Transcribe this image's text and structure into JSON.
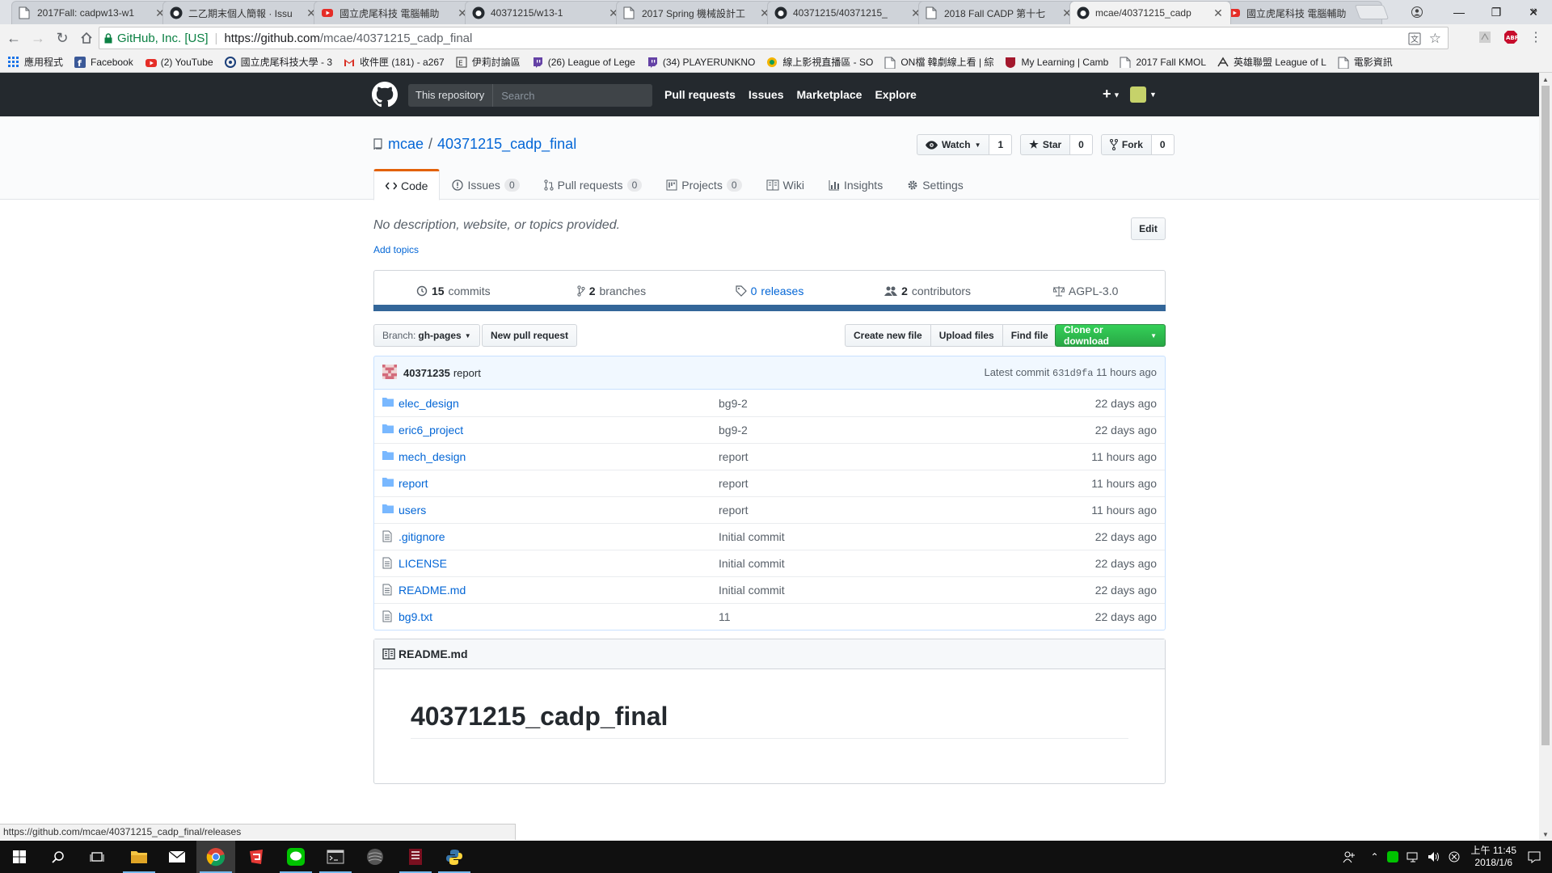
{
  "browser": {
    "tabs": [
      {
        "title": "2017Fall: cadpw13-w1",
        "favicon": "page-icon",
        "active": false
      },
      {
        "title": "二乙期末個人簡報 · Issu",
        "favicon": "github-icon",
        "active": false
      },
      {
        "title": "國立虎尾科技 電腦輔助",
        "favicon": "youtube-icon",
        "active": false
      },
      {
        "title": "40371215/w13-1",
        "favicon": "github-icon",
        "active": false
      },
      {
        "title": "2017 Spring 機械設計工",
        "favicon": "page-icon",
        "active": false
      },
      {
        "title": "40371215/40371215_",
        "favicon": "github-icon",
        "active": false
      },
      {
        "title": "2018 Fall CADP 第十七",
        "favicon": "page-icon",
        "active": false
      },
      {
        "title": "mcae/40371215_cadp",
        "favicon": "github-icon",
        "active": true
      },
      {
        "title": "國立虎尾科技 電腦輔助",
        "favicon": "youtube-icon",
        "active": false
      }
    ],
    "secure_label": "GitHub, Inc. [US]",
    "url_host": "https://github.com",
    "url_path": "/mcae/40371215_cadp_final",
    "bookmarks": [
      {
        "label": "應用程式",
        "icon": "apps-icon"
      },
      {
        "label": "Facebook",
        "icon": "facebook-icon"
      },
      {
        "label": "(2) YouTube",
        "icon": "youtube-icon"
      },
      {
        "label": "國立虎尾科技大學 - 3",
        "icon": "university-icon"
      },
      {
        "label": "收件匣 (181) - a267",
        "icon": "gmail-icon"
      },
      {
        "label": "伊莉討論區",
        "icon": "forum-icon"
      },
      {
        "label": "(26) League of Lege",
        "icon": "twitch-icon"
      },
      {
        "label": "(34) PLAYERUNKNO",
        "icon": "twitch-icon"
      },
      {
        "label": "線上影視直播區 - SO",
        "icon": "stream-icon"
      },
      {
        "label": "ON檔 韓劇線上看 | 綜",
        "icon": "page-icon"
      },
      {
        "label": "My Learning | Camb",
        "icon": "cambridge-icon"
      },
      {
        "label": "2017 Fall KMOL",
        "icon": "page-icon"
      },
      {
        "label": "英雄聯盟 League of L",
        "icon": "lol-icon"
      },
      {
        "label": "電影資訊",
        "icon": "page-icon"
      }
    ],
    "status_url": "https://github.com/mcae/40371215_cadp_final/releases"
  },
  "github": {
    "scope_label": "This repository",
    "search_placeholder": "Search",
    "nav": [
      "Pull requests",
      "Issues",
      "Marketplace",
      "Explore"
    ],
    "owner": "mcae",
    "repo": "40371215_cadp_final",
    "actions": {
      "watch_label": "Watch",
      "watch_count": "1",
      "star_label": "Star",
      "star_count": "0",
      "fork_label": "Fork",
      "fork_count": "0"
    },
    "tabs": [
      {
        "label": "Code",
        "counter": null,
        "icon": "code-icon",
        "selected": true
      },
      {
        "label": "Issues",
        "counter": "0",
        "icon": "issue-icon",
        "selected": false
      },
      {
        "label": "Pull requests",
        "counter": "0",
        "icon": "pull-request-icon",
        "selected": false
      },
      {
        "label": "Projects",
        "counter": "0",
        "icon": "project-icon",
        "selected": false
      },
      {
        "label": "Wiki",
        "counter": null,
        "icon": "wiki-icon",
        "selected": false
      },
      {
        "label": "Insights",
        "counter": null,
        "icon": "graph-icon",
        "selected": false
      },
      {
        "label": "Settings",
        "counter": null,
        "icon": "gear-icon",
        "selected": false
      }
    ],
    "description": "No description, website, or topics provided.",
    "add_topics": "Add topics",
    "edit_label": "Edit",
    "summary": {
      "commits_num": "15",
      "commits_label": "commits",
      "branches_num": "2",
      "branches_label": "branches",
      "releases_num": "0",
      "releases_label": "releases",
      "contributors_num": "2",
      "contributors_label": "contributors",
      "license": "AGPL-3.0"
    },
    "lang_color": "#336699",
    "branch_prefix": "Branch:",
    "branch_name": "gh-pages",
    "new_pr_label": "New pull request",
    "create_file_label": "Create new file",
    "upload_label": "Upload files",
    "find_label": "Find file",
    "clone_label": "Clone or download",
    "latest_commit": {
      "author": "40371235",
      "message": "report",
      "prefix": "Latest commit",
      "sha": "631d9fa",
      "age": "11 hours ago"
    },
    "files": [
      {
        "type": "dir",
        "name": "elec_design",
        "message": "bg9-2",
        "age": "22 days ago"
      },
      {
        "type": "dir",
        "name": "eric6_project",
        "message": "bg9-2",
        "age": "22 days ago"
      },
      {
        "type": "dir",
        "name": "mech_design",
        "message": "report",
        "age": "11 hours ago"
      },
      {
        "type": "dir",
        "name": "report",
        "message": "report",
        "age": "11 hours ago"
      },
      {
        "type": "dir",
        "name": "users",
        "message": "report",
        "age": "11 hours ago"
      },
      {
        "type": "file",
        "name": ".gitignore",
        "message": "Initial commit",
        "age": "22 days ago"
      },
      {
        "type": "file",
        "name": "LICENSE",
        "message": "Initial commit",
        "age": "22 days ago"
      },
      {
        "type": "file",
        "name": "README.md",
        "message": "Initial commit",
        "age": "22 days ago"
      },
      {
        "type": "file",
        "name": "bg9.txt",
        "message": "11",
        "age": "22 days ago"
      }
    ],
    "readme_filename": "README.md",
    "readme_heading": "40371215_cadp_final"
  },
  "taskbar": {
    "time": "上午 11:45",
    "date": "2018/1/6",
    "apps": [
      "start-icon",
      "search-icon",
      "task-view-icon",
      "file-explorer-icon",
      "mail-icon",
      "chrome-icon",
      "garena-icon",
      "line-icon",
      "terminal-icon",
      "app-icon",
      "game-icon",
      "python-icon"
    ]
  }
}
